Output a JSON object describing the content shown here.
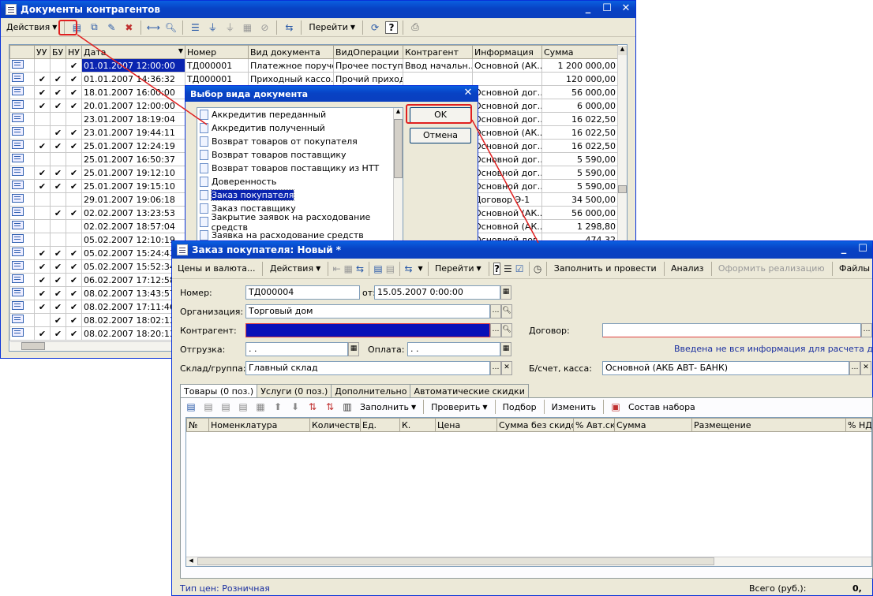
{
  "back_window": {
    "title": "Документы контрагентов",
    "toolbar": {
      "actions_label": "Действия",
      "goto_label": "Перейти"
    },
    "columns": [
      "УУ",
      "БУ",
      "НУ",
      "Дата",
      "Номер",
      "Вид документа",
      "ВидОперации",
      "Контрагент",
      "Информация",
      "Сумма"
    ],
    "rows": [
      {
        "uu": "",
        "bu": "",
        "nu": "✔",
        "date": "01.01.2007 12:00:00",
        "num": "ТД000001",
        "doc": "Платежное поруче...",
        "op": "Прочее поступ...",
        "kontr": "Ввод начальн...",
        "info": "Основной  (АК...",
        "sum": "1 200 000,00"
      },
      {
        "uu": "✔",
        "bu": "✔",
        "nu": "✔",
        "date": "01.01.2007 14:36:32",
        "num": "ТД000001",
        "doc": "Приходный кассо...",
        "op": "Прочий приход...",
        "kontr": "",
        "info": "",
        "sum": "120 000,00"
      },
      {
        "uu": "✔",
        "bu": "✔",
        "nu": "✔",
        "date": "18.01.2007 16:00:00",
        "num": "",
        "doc": "",
        "op": "",
        "kontr": "",
        "info": "Основной дог...",
        "sum": "56 000,00"
      },
      {
        "uu": "✔",
        "bu": "✔",
        "nu": "✔",
        "date": "20.01.2007 12:00:00",
        "num": "",
        "doc": "",
        "op": "",
        "kontr": "",
        "info": "Основной дог...",
        "sum": "6 000,00"
      },
      {
        "uu": "",
        "bu": "",
        "nu": "",
        "date": "23.01.2007 18:19:04",
        "num": "",
        "doc": "",
        "op": "",
        "kontr": "",
        "info": "Основной дог...",
        "sum": "16 022,50"
      },
      {
        "uu": "",
        "bu": "✔",
        "nu": "✔",
        "date": "23.01.2007 19:44:11",
        "num": "",
        "doc": "",
        "op": "",
        "kontr": "",
        "info": "Основной  (АК...",
        "sum": "16 022,50"
      },
      {
        "uu": "✔",
        "bu": "✔",
        "nu": "✔",
        "date": "25.01.2007 12:24:19",
        "num": "",
        "doc": "",
        "op": "",
        "kontr": "",
        "info": "Основной дог...",
        "sum": "16 022,50"
      },
      {
        "uu": "",
        "bu": "",
        "nu": "",
        "date": "25.01.2007 16:50:37",
        "num": "",
        "doc": "",
        "op": "",
        "kontr": "",
        "info": "Основной дог...",
        "sum": "5 590,00"
      },
      {
        "uu": "✔",
        "bu": "✔",
        "nu": "✔",
        "date": "25.01.2007 19:12:10",
        "num": "",
        "doc": "",
        "op": "",
        "kontr": "",
        "info": "Основной дог...",
        "sum": "5 590,00"
      },
      {
        "uu": "✔",
        "bu": "✔",
        "nu": "✔",
        "date": "25.01.2007 19:15:10",
        "num": "",
        "doc": "",
        "op": "",
        "kontr": "",
        "info": "Основной дог...",
        "sum": "5 590,00"
      },
      {
        "uu": "",
        "bu": "",
        "nu": "",
        "date": "29.01.2007 19:06:18",
        "num": "",
        "doc": "",
        "op": "",
        "kontr": "",
        "info": "Договор Э-1",
        "sum": "34 500,00"
      },
      {
        "uu": "",
        "bu": "✔",
        "nu": "✔",
        "date": "02.02.2007 13:23:53",
        "num": "",
        "doc": "",
        "op": "",
        "kontr": "",
        "info": "Основной  (АК...",
        "sum": "56 000,00"
      },
      {
        "uu": "",
        "bu": "",
        "nu": "",
        "date": "02.02.2007 18:57:04",
        "num": "",
        "doc": "",
        "op": "",
        "kontr": "",
        "info": "Основной  (АК...",
        "sum": "1 298,80"
      },
      {
        "uu": "",
        "bu": "",
        "nu": "",
        "date": "05.02.2007 12:10:19",
        "num": "",
        "doc": "",
        "op": "",
        "kontr": "",
        "info": "Основной дог...",
        "sum": "474,32"
      },
      {
        "uu": "✔",
        "bu": "✔",
        "nu": "✔",
        "date": "05.02.2007 15:24:43",
        "num": "",
        "doc": "",
        "op": "",
        "kontr": "",
        "info": "",
        "sum": ""
      },
      {
        "uu": "✔",
        "bu": "✔",
        "nu": "✔",
        "date": "05.02.2007 15:52:34",
        "num": "",
        "doc": "",
        "op": "",
        "kontr": "",
        "info": "",
        "sum": ""
      },
      {
        "uu": "✔",
        "bu": "✔",
        "nu": "✔",
        "date": "06.02.2007 17:12:58",
        "num": "",
        "doc": "",
        "op": "",
        "kontr": "",
        "info": "",
        "sum": ""
      },
      {
        "uu": "✔",
        "bu": "✔",
        "nu": "✔",
        "date": "08.02.2007 13:43:57",
        "num": "",
        "doc": "",
        "op": "",
        "kontr": "",
        "info": "",
        "sum": ""
      },
      {
        "uu": "✔",
        "bu": "✔",
        "nu": "✔",
        "date": "08.02.2007 17:11:46",
        "num": "",
        "doc": "",
        "op": "",
        "kontr": "",
        "info": "",
        "sum": ""
      },
      {
        "uu": "",
        "bu": "✔",
        "nu": "✔",
        "date": "08.02.2007 18:02:13",
        "num": "",
        "doc": "",
        "op": "",
        "kontr": "",
        "info": "",
        "sum": ""
      },
      {
        "uu": "✔",
        "bu": "✔",
        "nu": "✔",
        "date": "08.02.2007 18:20:13",
        "num": "",
        "doc": "",
        "op": "",
        "kontr": "",
        "info": "",
        "sum": ""
      }
    ]
  },
  "dialog": {
    "title": "Выбор вида документа",
    "items": [
      "Аккредитив переданный",
      "Аккредитив полученный",
      "Возврат товаров от покупателя",
      "Возврат товаров поставщику",
      "Возврат товаров поставщику из НТТ",
      "Доверенность",
      "Заказ покупателя",
      "Заказ поставщику",
      "Закрытие заявок на расходование средств",
      "Заявка на расходование средств"
    ],
    "selected_index": 6,
    "ok_label": "OK",
    "cancel_label": "Отмена"
  },
  "order_window": {
    "title": "Заказ покупателя: Новый *",
    "toolbar": {
      "prices_label": "Цены и валюта...",
      "actions_label": "Действия",
      "goto_label": "Перейти",
      "fill_post_label": "Заполнить и провести",
      "analysis_label": "Анализ",
      "make_sale_label": "Оформить реализацию",
      "files_label": "Файлы"
    },
    "form": {
      "number_label": "Номер:",
      "number_value": "ТД000004",
      "date_label": "от:",
      "date_value": "15.05.2007  0:00:00",
      "org_label": "Организация:",
      "org_value": "Торговый дом",
      "kontr_label": "Контрагент:",
      "kontr_value": "",
      "contract_label": "Договор:",
      "contract_value": "",
      "ship_label": "Отгрузка:",
      "ship_value": " .  .",
      "pay_label": "Оплата:",
      "pay_value": " .  .",
      "warning": "Введена не вся информация для расчета долга.",
      "store_label": "Склад/группа:",
      "store_value": "Главный склад",
      "account_label": "Б/счет, касса:",
      "account_value": "Основной  (АКБ АВТ- БАНК)"
    },
    "tabs": [
      "Товары (0 поз.)",
      "Услуги (0 поз.)",
      "Дополнительно",
      "Автоматические скидки"
    ],
    "table_toolbar": {
      "fill_label": "Заполнить",
      "check_label": "Проверить",
      "select_label": "Подбор",
      "change_label": "Изменить",
      "kit_label": "Состав набора"
    },
    "columns": [
      "№",
      "Номенклатура",
      "Количество",
      "Ед.",
      "К.",
      "Цена",
      "Сумма без скидок",
      "% Авт.ск.",
      "Сумма",
      "Размещение",
      "% НДС"
    ],
    "footer": {
      "price_type": "Тип цен: Розничная",
      "total_label": "Всего (руб.):",
      "total_value": "0,"
    }
  }
}
